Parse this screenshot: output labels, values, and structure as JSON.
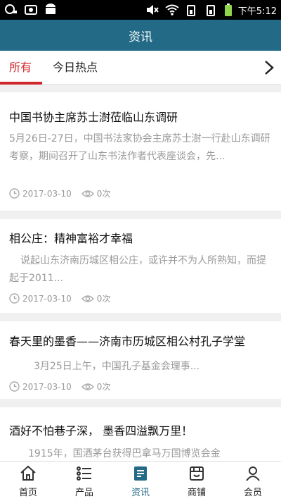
{
  "status_bar": {
    "time": "下午5:12"
  },
  "header": {
    "title": "资讯"
  },
  "tabs": [
    {
      "label": "所有",
      "active": true
    },
    {
      "label": "今日热点",
      "active": false
    }
  ],
  "articles": [
    {
      "title": "中国书协主席苏士澍莅临山东调研",
      "summary": "5月26日-27日，中国书法家协会主席苏士澍一行赴山东调研考察，期间召开了山东书法作者代表座谈会，先...",
      "date": "2017-03-10",
      "views": "0次"
    },
    {
      "title": "相公庄：精神富裕才幸福",
      "summary": "说起山东济南历城区相公庄，或许并不为人所熟知，而提起于2011...",
      "date": "2017-03-10",
      "views": "0次"
    },
    {
      "title": "春天里的墨香——济南市历城区相公村孔子学堂",
      "summary": "3月25日上午，中国孔子基金会理事...",
      "date": "2017-03-10",
      "views": "0次"
    },
    {
      "title": "酒好不怕巷子深， 墨香四溢飘万里！",
      "summary": "1915年，国酒茅台获得巴拿马万国博览会金",
      "date": "",
      "views": ""
    }
  ],
  "bottom_nav": [
    {
      "label": "首页",
      "icon": "home-icon",
      "active": false
    },
    {
      "label": "产品",
      "icon": "product-list-icon",
      "active": false
    },
    {
      "label": "资讯",
      "icon": "news-icon",
      "active": true
    },
    {
      "label": "商铺",
      "icon": "store-icon",
      "active": false
    },
    {
      "label": "会员",
      "icon": "member-icon",
      "active": false
    }
  ],
  "colors": {
    "header_bg": "#226a86",
    "accent_red": "#d0262c",
    "active_nav": "#226a86"
  }
}
